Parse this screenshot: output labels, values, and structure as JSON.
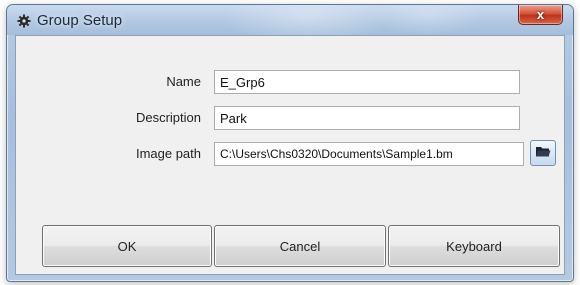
{
  "window": {
    "title": "Group Setup",
    "close_label": "x"
  },
  "form": {
    "name_label": "Name",
    "name_value": "E_Grp6",
    "description_label": "Description",
    "description_value": "Park",
    "image_path_label": "Image path",
    "image_path_value": "C:\\Users\\Chs0320\\Documents\\Sample1.bm"
  },
  "buttons": {
    "ok": "OK",
    "cancel": "Cancel",
    "keyboard": "Keyboard"
  },
  "icons": {
    "app": "gear-icon",
    "browse": "folder-icon",
    "close": "close-icon"
  }
}
